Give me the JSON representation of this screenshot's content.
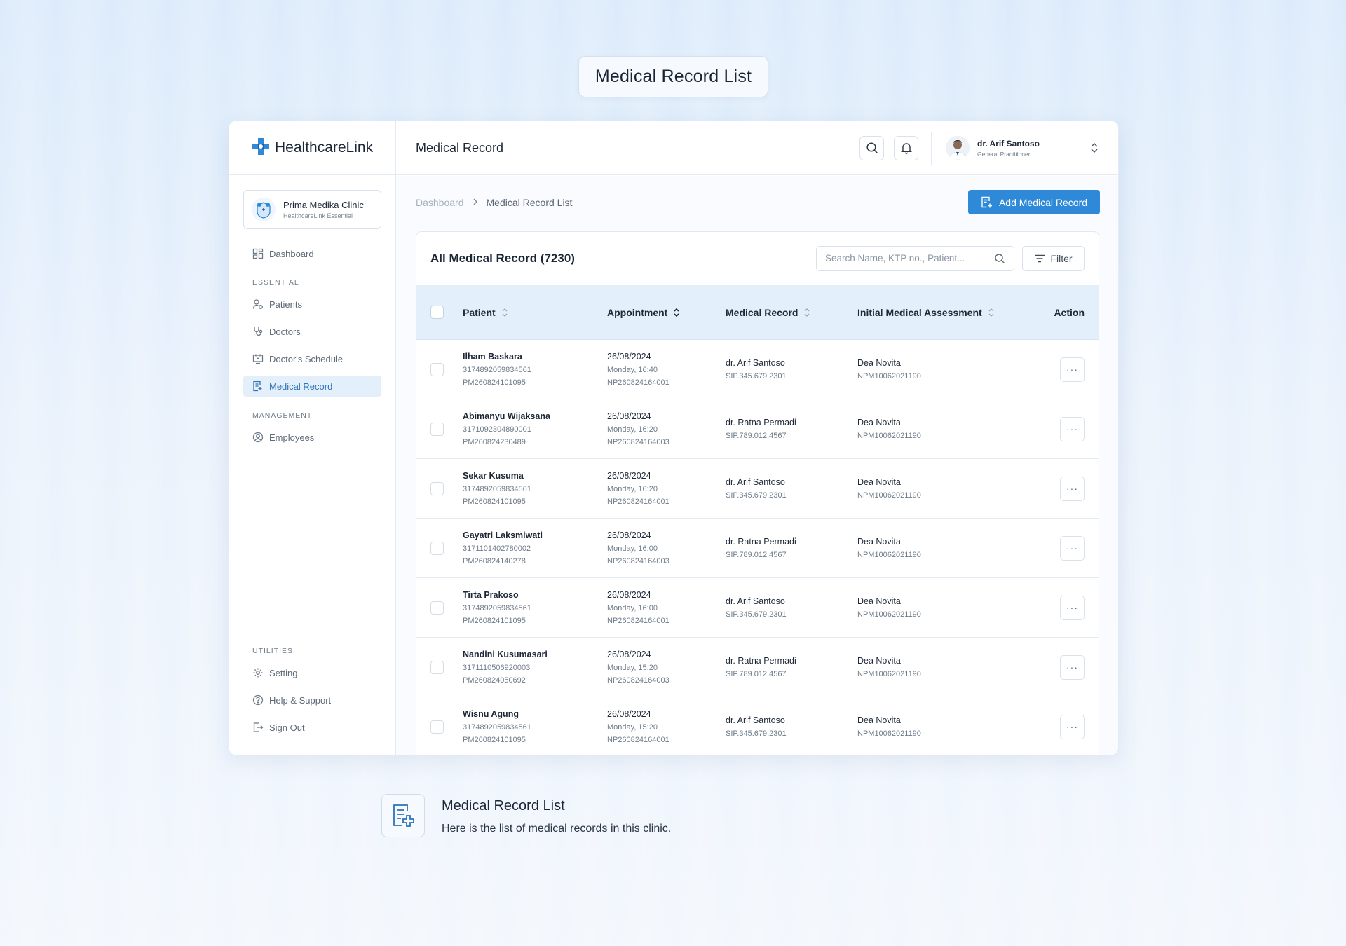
{
  "hero": {
    "title": "Medical Record List"
  },
  "brand": {
    "name": "HealthcareLink"
  },
  "clinic": {
    "name": "Prima Medika Clinic",
    "plan": "HealthcareLink Essential"
  },
  "sidebar": {
    "dashboard": "Dashboard",
    "essential_label": "ESSENTIAL",
    "essential": [
      {
        "label": "Patients",
        "icon": "patients-icon"
      },
      {
        "label": "Doctors",
        "icon": "stethoscope-icon"
      },
      {
        "label": "Doctor's Schedule",
        "icon": "schedule-icon"
      },
      {
        "label": "Medical Record",
        "icon": "medical-record-icon",
        "active": true
      }
    ],
    "management_label": "MANAGEMENT",
    "employees": "Employees",
    "utilities_label": "UTILITIES",
    "setting": "Setting",
    "help": "Help & Support",
    "signout": "Sign Out"
  },
  "header": {
    "title": "Medical Record",
    "user": {
      "name": "dr. Arif Santoso",
      "role": "General Practitioner"
    }
  },
  "breadcrumb": {
    "root": "Dashboard",
    "current": "Medical Record List"
  },
  "actions": {
    "add": "Add Medical Record"
  },
  "table": {
    "title": "All Medical Record (7230)",
    "search_placeholder": "Search Name, KTP no., Patient...",
    "filter": "Filter",
    "columns": {
      "patient": "Patient",
      "appointment": "Appointment",
      "medical_record": "Medical Record",
      "assessment": "Initial Medical Assessment",
      "action": "Action"
    },
    "rows": [
      {
        "name": "Ilham Baskara",
        "ktp": "3174892059834561",
        "pm": "PM260824101095",
        "date": "26/08/2024",
        "time": "Monday, 16:40",
        "np": "NP260824164001",
        "doctor": "dr. Arif Santoso",
        "sip": "SIP.345.679.2301",
        "assessor": "Dea Novita",
        "npm": "NPM10062021190"
      },
      {
        "name": "Abimanyu Wijaksana",
        "ktp": "3171092304890001",
        "pm": "PM260824230489",
        "date": "26/08/2024",
        "time": "Monday, 16:20",
        "np": "NP260824164003",
        "doctor": "dr. Ratna Permadi",
        "sip": "SIP.789.012.4567",
        "assessor": "Dea Novita",
        "npm": "NPM10062021190"
      },
      {
        "name": "Sekar Kusuma",
        "ktp": "3174892059834561",
        "pm": "PM260824101095",
        "date": "26/08/2024",
        "time": "Monday, 16:20",
        "np": "NP260824164001",
        "doctor": "dr. Arif Santoso",
        "sip": "SIP.345.679.2301",
        "assessor": "Dea Novita",
        "npm": "NPM10062021190"
      },
      {
        "name": "Gayatri Laksmiwati",
        "ktp": "3171101402780002",
        "pm": "PM260824140278",
        "date": "26/08/2024",
        "time": "Monday, 16:00",
        "np": "NP260824164003",
        "doctor": "dr. Ratna Permadi",
        "sip": "SIP.789.012.4567",
        "assessor": "Dea Novita",
        "npm": "NPM10062021190"
      },
      {
        "name": "Tirta Prakoso",
        "ktp": "3174892059834561",
        "pm": "PM260824101095",
        "date": "26/08/2024",
        "time": "Monday, 16:00",
        "np": "NP260824164001",
        "doctor": "dr. Arif Santoso",
        "sip": "SIP.345.679.2301",
        "assessor": "Dea Novita",
        "npm": "NPM10062021190"
      },
      {
        "name": "Nandini Kusumasari",
        "ktp": "3171110506920003",
        "pm": "PM260824050692",
        "date": "26/08/2024",
        "time": "Monday, 15:20",
        "np": "NP260824164003",
        "doctor": "dr. Ratna Permadi",
        "sip": "SIP.789.012.4567",
        "assessor": "Dea Novita",
        "npm": "NPM10062021190"
      },
      {
        "name": "Wisnu Agung",
        "ktp": "3174892059834561",
        "pm": "PM260824101095",
        "date": "26/08/2024",
        "time": "Monday, 15:20",
        "np": "NP260824164001",
        "doctor": "dr. Arif Santoso",
        "sip": "SIP.345.679.2301",
        "assessor": "Dea Novita",
        "npm": "NPM10062021190"
      }
    ],
    "row_action": "···"
  },
  "caption": {
    "title": "Medical Record List",
    "description": "Here is the list of medical records in this clinic."
  },
  "colors": {
    "accent": "#2e8ad8",
    "active_bg": "#e3effb",
    "header_bg": "#e3effb"
  }
}
